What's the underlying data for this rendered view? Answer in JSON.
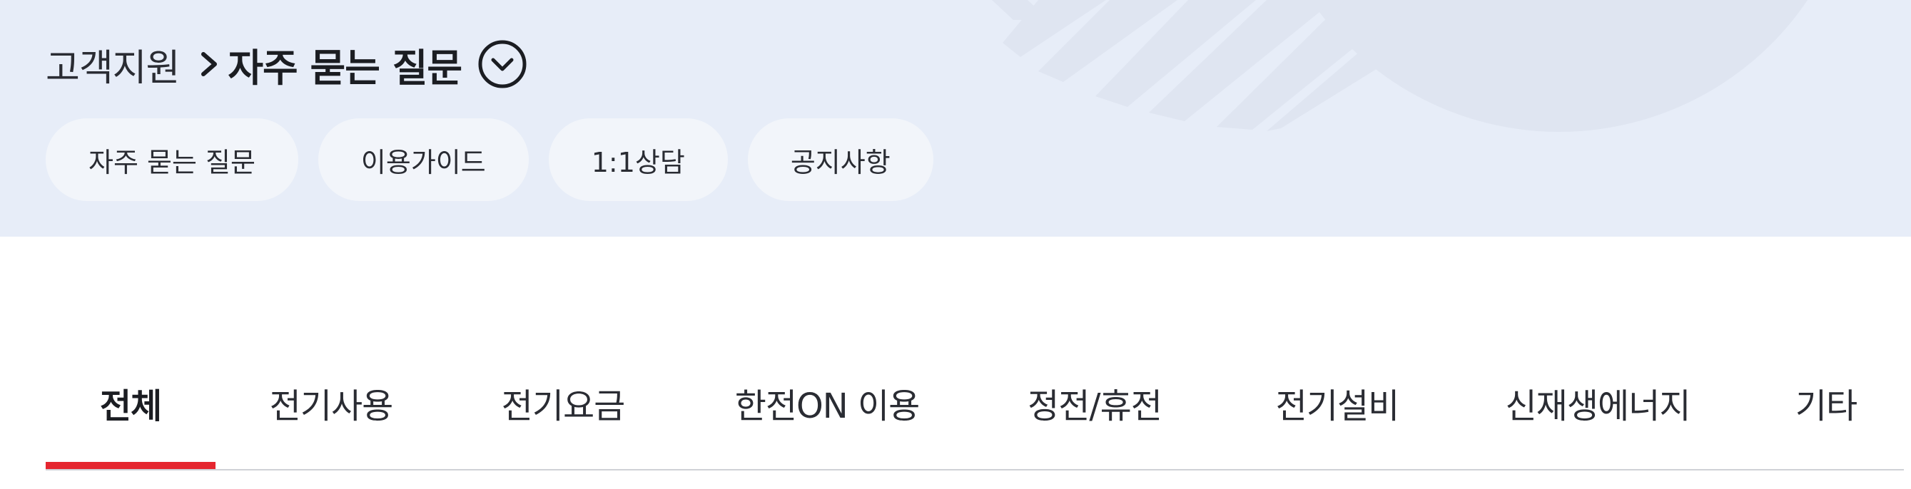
{
  "breadcrumb": {
    "root": "고객지원",
    "current": "자주 묻는 질문",
    "separator_icon": "chevron-right-icon",
    "toggle_icon": "chevron-down-circle-icon"
  },
  "quick_links": [
    {
      "label": "자주 묻는 질문"
    },
    {
      "label": "이용가이드"
    },
    {
      "label": "1:1상담"
    },
    {
      "label": "공지사항"
    }
  ],
  "tabs": [
    {
      "label": "전체",
      "active": true
    },
    {
      "label": "전기사용",
      "active": false
    },
    {
      "label": "전기요금",
      "active": false
    },
    {
      "label": "한전ON 이용",
      "active": false
    },
    {
      "label": "정전/휴전",
      "active": false
    },
    {
      "label": "전기설비",
      "active": false
    },
    {
      "label": "신재생에너지",
      "active": false
    },
    {
      "label": "기타",
      "active": false
    }
  ],
  "colors": {
    "hero_background": "#e7edf8",
    "chip_background": "#f2f5fa",
    "active_tab_indicator": "#e5262f",
    "text_primary": "#1b1d22"
  }
}
